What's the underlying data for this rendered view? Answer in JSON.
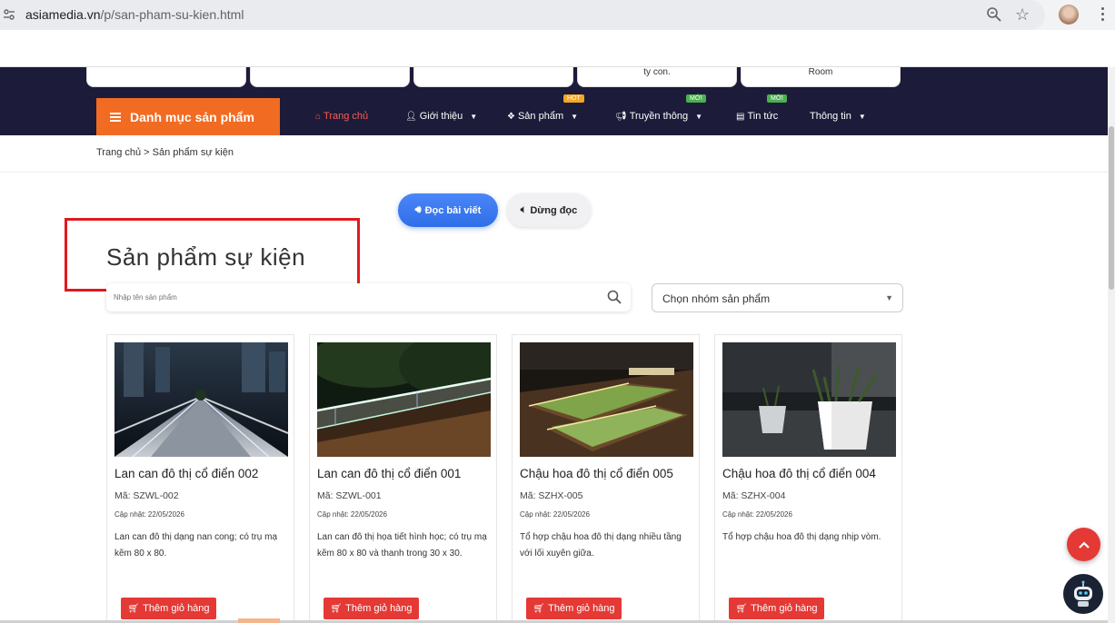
{
  "browser": {
    "url_domain": "asiamedia.vn",
    "url_path": "/p/san-pham-su-kien.html"
  },
  "top_cards": [
    "",
    "",
    "",
    "ty con.",
    "Room"
  ],
  "nav": {
    "menu_label": "Danh mục sản phẩm",
    "items": [
      {
        "label": "Trang chủ",
        "icon": "home-icon",
        "active": true
      },
      {
        "label": "Giới thiệu",
        "icon": "user-icon",
        "caret": true
      },
      {
        "label": "Sản phẩm",
        "icon": "cubes-icon",
        "caret": true,
        "tag": "HOT"
      },
      {
        "label": "Truyền thông",
        "icon": "megaphone-icon",
        "caret": true,
        "tag": "MỚI"
      },
      {
        "label": "Tin tức",
        "icon": "newspaper-icon",
        "tag": "MỚI"
      },
      {
        "label": "Thông tin",
        "caret": true
      }
    ]
  },
  "breadcrumb": "Trang chủ > Sản phẩm sự kiện",
  "reader": {
    "read_label": "Đọc bài viết",
    "stop_label": "Dừng đọc"
  },
  "page_title": "Sản phẩm sự kiện",
  "search": {
    "placeholder": "Nhập tên sản phẩm"
  },
  "group_select": {
    "selected": "Chọn nhóm sản phẩm"
  },
  "cart_label": "Thêm giỏ hàng",
  "products": [
    {
      "name": "Lan can đô thị cổ điển 002",
      "code": "Mã: SZWL-002",
      "date": "Cập nhật: 22/05/2026",
      "desc": "Lan can đô thị dạng nan cong; có trụ mạ kẽm 80 x 80."
    },
    {
      "name": "Lan can đô thị cổ điển 001",
      "code": "Mã: SZWL-001",
      "date": "Cập nhật: 22/05/2026",
      "desc": "Lan can đô thị họa tiết hình học; có trụ mạ kẽm 80 x 80 và thanh trong 30 x 30."
    },
    {
      "name": "Chậu hoa đô thị cổ điển 005",
      "code": "Mã: SZHX-005",
      "date": "Cập nhật: 22/05/2026",
      "desc": "Tổ hợp chậu hoa đô thị dạng nhiều tầng với lối xuyên giữa."
    },
    {
      "name": "Chậu hoa đô thị cổ điển 004",
      "code": "Mã: SZHX-004",
      "date": "Cập nhật: 22/05/2026",
      "desc": "Tổ hợp chậu hoa đô thị dạng nhịp vòm."
    }
  ],
  "colors": {
    "navbar": "#1c1b3a",
    "menu_button": "#f26b22",
    "accent_red": "#e53935",
    "read_button": "#2f6ee9"
  }
}
